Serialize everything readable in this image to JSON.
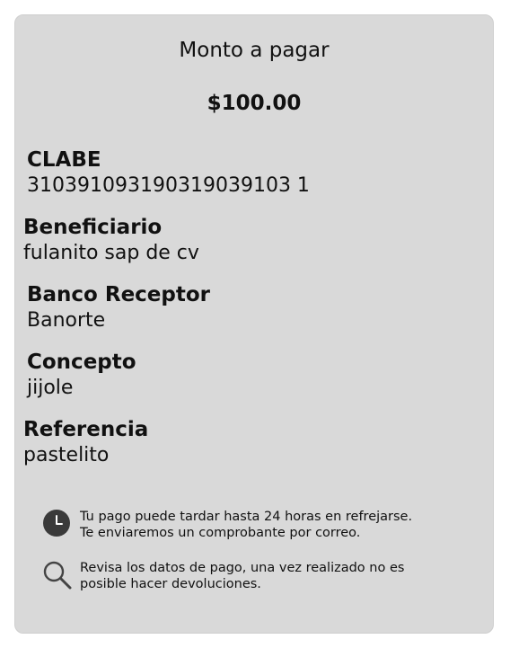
{
  "payment": {
    "title": "Monto a pagar",
    "amount": "$100.00"
  },
  "fields": [
    {
      "label": "CLABE",
      "value": "310391093190319039103 1"
    },
    {
      "label": "Beneficiario",
      "value": "fulanito sap de cv"
    },
    {
      "label": "Banco Receptor",
      "value": "Banorte"
    },
    {
      "label": "Concepto",
      "value": "jijole"
    },
    {
      "label": "Referencia",
      "value": "pastelito"
    }
  ],
  "notices": [
    {
      "icon": "clock-icon",
      "line1": "Tu pago puede tardar hasta 24 horas en refrejarse.",
      "line2": "Te enviaremos un comprobante por correo."
    },
    {
      "icon": "search-icon",
      "line1": "Revisa los datos de pago, una vez realizado no es",
      "line2": "posible hacer devoluciones."
    }
  ]
}
